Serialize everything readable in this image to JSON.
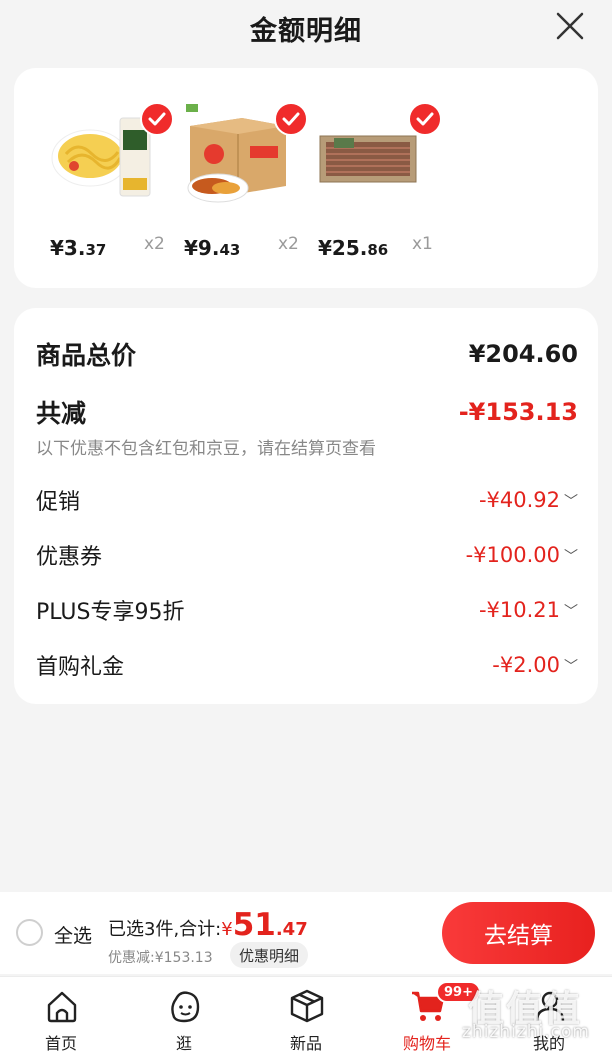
{
  "header": {
    "title": "金额明细",
    "close_icon": "close-icon"
  },
  "products": [
    {
      "image": "spaghetti-noodles-package",
      "price_int": "¥3.",
      "price_dec": "37",
      "qty": "x2",
      "checked": true
    },
    {
      "image": "sweet-potato-box",
      "price_int": "¥9.",
      "price_dec": "43",
      "qty": "x2",
      "checked": true
    },
    {
      "image": "sausage-gift-box",
      "price_int": "¥25.",
      "price_dec": "86",
      "qty": "x1",
      "checked": true
    }
  ],
  "summary": {
    "total_label": "商品总价",
    "total_value": "¥204.60",
    "reduce_label": "共减",
    "reduce_value": "-¥153.13",
    "note": "以下优惠不包含红包和京豆，请在结算页查看",
    "items": [
      {
        "label": "促销",
        "value": "-¥40.92"
      },
      {
        "label": "优惠券",
        "value": "-¥100.00"
      },
      {
        "label": "PLUS专享95折",
        "value": "-¥10.21"
      },
      {
        "label": "首购礼金",
        "value": "-¥2.00"
      }
    ]
  },
  "settle": {
    "select_all": "全选",
    "selected_text": "已选3件,合计:",
    "currency": "¥",
    "total_int": "51",
    "total_dec": ".47",
    "discount_text": "优惠减:¥153.13",
    "detail_chip": "优惠明细",
    "checkout": "去结算"
  },
  "tabs": [
    {
      "label": "首页",
      "icon": "home-icon",
      "active": false
    },
    {
      "label": "逛",
      "icon": "browse-face-icon",
      "active": false
    },
    {
      "label": "新品",
      "icon": "box-icon",
      "active": false
    },
    {
      "label": "购物车",
      "icon": "cart-icon",
      "active": true,
      "badge": "99+"
    },
    {
      "label": "我的",
      "icon": "profile-icon",
      "active": false
    }
  ],
  "watermark": {
    "logo": "值值值",
    "url": "zhizhizhi.com"
  },
  "colors": {
    "accent": "#e3231d",
    "background": "#f4f4f4"
  }
}
